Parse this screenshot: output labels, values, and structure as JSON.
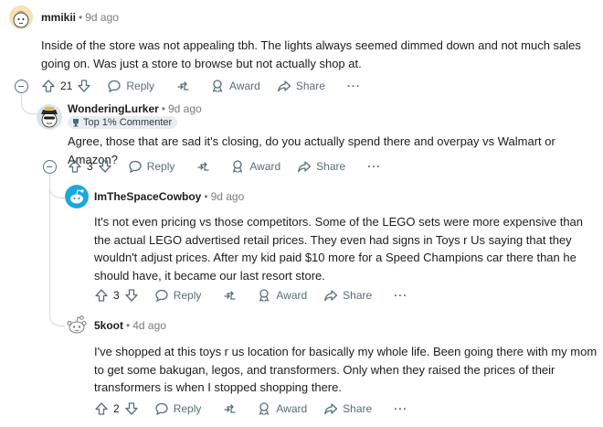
{
  "comments": [
    {
      "author": "mmikii",
      "time": "9d ago",
      "body": "Inside of the store was not appealing tbh. The lights always seemed dimmed down and not much sales going on. Was just a store to browse but not actually shop at.",
      "votes": "21",
      "reply_label": "Reply",
      "award_label": "Award",
      "share_label": "Share",
      "more_label": "···"
    },
    {
      "author": "WonderingLurker",
      "time": "9d ago",
      "flair": "Top 1% Commenter",
      "body": "Agree, those that are sad it's closing, do you actually spend there and overpay vs Walmart or Amazon?",
      "votes": "3",
      "reply_label": "Reply",
      "award_label": "Award",
      "share_label": "Share",
      "more_label": "···"
    },
    {
      "author": "ImTheSpaceCowboy",
      "time": "9d ago",
      "body": "It's not even pricing vs those competitors. Some of the LEGO sets were more expensive than the actual LEGO advertised retail prices. They even had signs in Toys r Us saying that they wouldn't adjust prices. After my kid paid $10 more for a Speed Champions car there than he should have, it became our last resort store.",
      "votes": "3",
      "reply_label": "Reply",
      "award_label": "Award",
      "share_label": "Share",
      "more_label": "···"
    },
    {
      "author": "5koot",
      "time": "4d ago",
      "body": "I've shopped at this toys r us location for basically my whole life. Been going there with my mom to get some bakugan, legos, and transformers. Only when they raised the prices of their transformers is when I stopped shopping there.",
      "votes": "2",
      "reply_label": "Reply",
      "award_label": "Award",
      "share_label": "Share",
      "more_label": "···"
    }
  ],
  "icons": {
    "upvote": "upvote-icon",
    "downvote": "downvote-icon",
    "reply": "reply-icon",
    "give": "give-icon",
    "award": "award-icon",
    "share": "share-icon",
    "collapse": "collapse-icon",
    "flair": "trophy-icon"
  },
  "colors": {
    "meta_gray": "#576f76",
    "thread_line": "#d3dadd",
    "flair_bg": "#eaedef",
    "cowboy_avatar": "#1aa7df",
    "wondering_avatar": "#e6b84a"
  }
}
